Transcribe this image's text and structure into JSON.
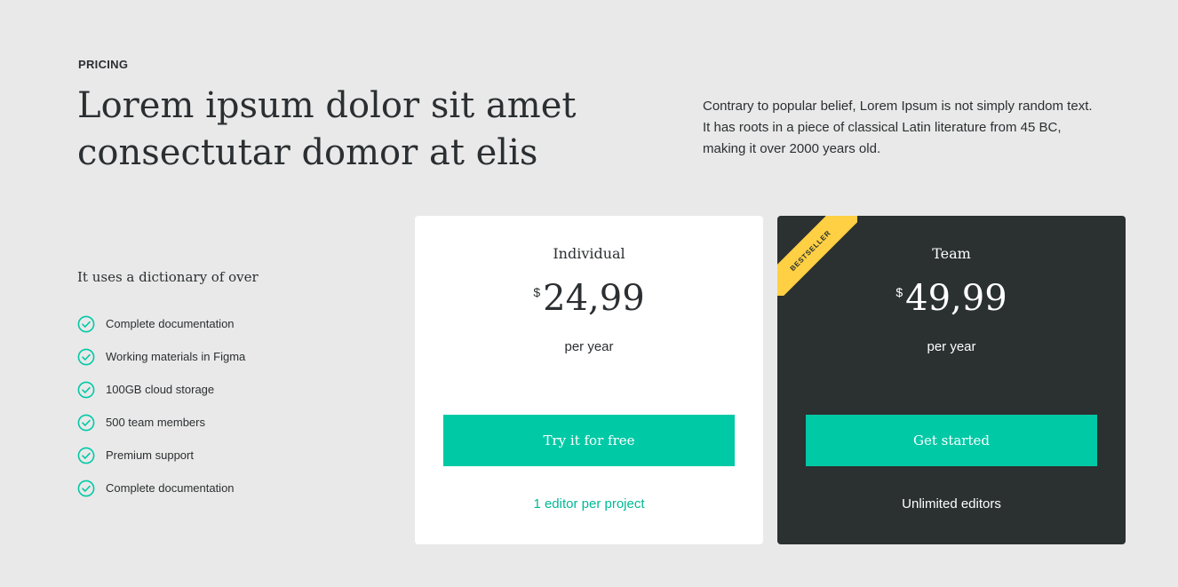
{
  "eyebrow": "PRICING",
  "headline": {
    "line1": "Lorem ipsum dolor sit amet",
    "line2": "consectutar domor at elis"
  },
  "intro": "Contrary to popular belief, Lorem Ipsum is not simply random text. It has roots in a piece of classical Latin literature from 45 BC, making it over 2000 years old.",
  "features": {
    "title": "It uses a dictionary of over",
    "items": [
      "Complete documentation",
      "Working materials in Figma",
      "100GB cloud storage",
      "500 team members",
      "Premium support",
      "Complete documentation"
    ],
    "icon": "check-circle-icon"
  },
  "plans": [
    {
      "name": "Individual",
      "currency": "$",
      "price": "24,99",
      "period": "per year",
      "cta": "Try it for free",
      "note": "1 editor per project"
    },
    {
      "name": "Team",
      "currency": "$",
      "price": "49,99",
      "period": "per year",
      "cta": "Get started",
      "note": "Unlimited editors",
      "badge": "BESTSELLER"
    }
  ],
  "colors": {
    "background": "#e9e9e9",
    "accent": "#00c9a6",
    "dark_card": "#2b3031",
    "badge": "#ffd043",
    "text": "#2b2f31"
  }
}
